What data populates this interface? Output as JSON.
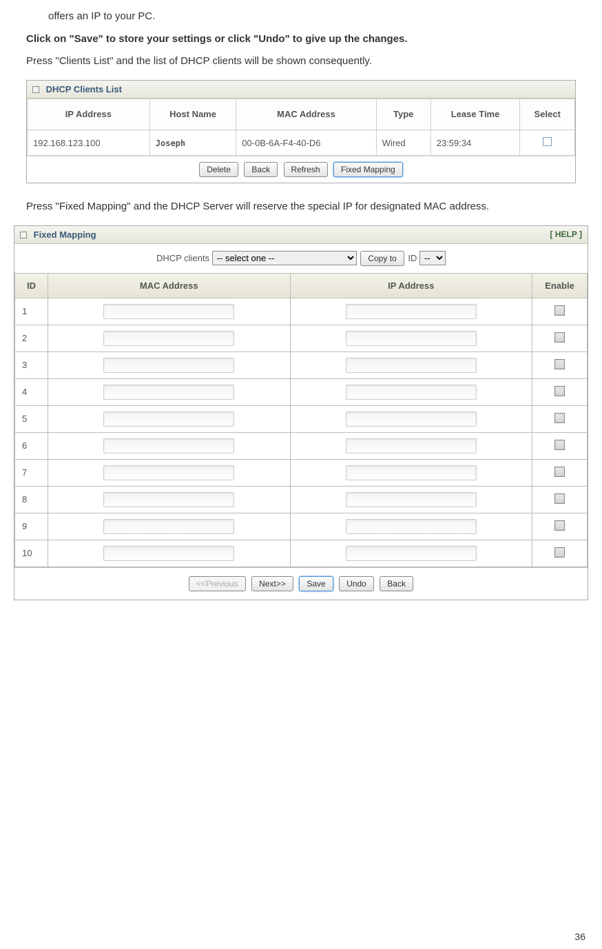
{
  "doc": {
    "line0": "offers an IP to your PC.",
    "line1": "Click on \"Save\" to store your settings or click \"Undo\" to give up the changes.",
    "line2": "Press \"Clients List\" and the list of DHCP clients will be shown consequently.",
    "line3": "Press \"Fixed Mapping\" and the DHCP Server will reserve the special IP for designated MAC address.",
    "page_number": "36"
  },
  "clients_panel": {
    "title": "DHCP Clients List",
    "headers": {
      "ip": "IP Address",
      "host": "Host Name",
      "mac": "MAC Address",
      "type": "Type",
      "lease": "Lease Time",
      "select": "Select"
    },
    "row": {
      "ip": "192.168.123.100",
      "host": "Joseph",
      "mac": "00-0B-6A-F4-40-D6",
      "type": "Wired",
      "lease": "23:59:34"
    },
    "buttons": {
      "delete": "Delete",
      "back": "Back",
      "refresh": "Refresh",
      "fixed": "Fixed Mapping"
    }
  },
  "mapping_panel": {
    "title": "Fixed Mapping",
    "help": "[ HELP ]",
    "copy_label": "DHCP clients",
    "select_one": "-- select one --",
    "copy_to": "Copy to",
    "id_label": "ID",
    "id_option": "--",
    "headers": {
      "id": "ID",
      "mac": "MAC Address",
      "ip": "IP Address",
      "enable": "Enable"
    },
    "rows": [
      "1",
      "2",
      "3",
      "4",
      "5",
      "6",
      "7",
      "8",
      "9",
      "10"
    ],
    "buttons": {
      "prev": "<<Previous",
      "next": "Next>>",
      "save": "Save",
      "undo": "Undo",
      "back": "Back"
    }
  }
}
